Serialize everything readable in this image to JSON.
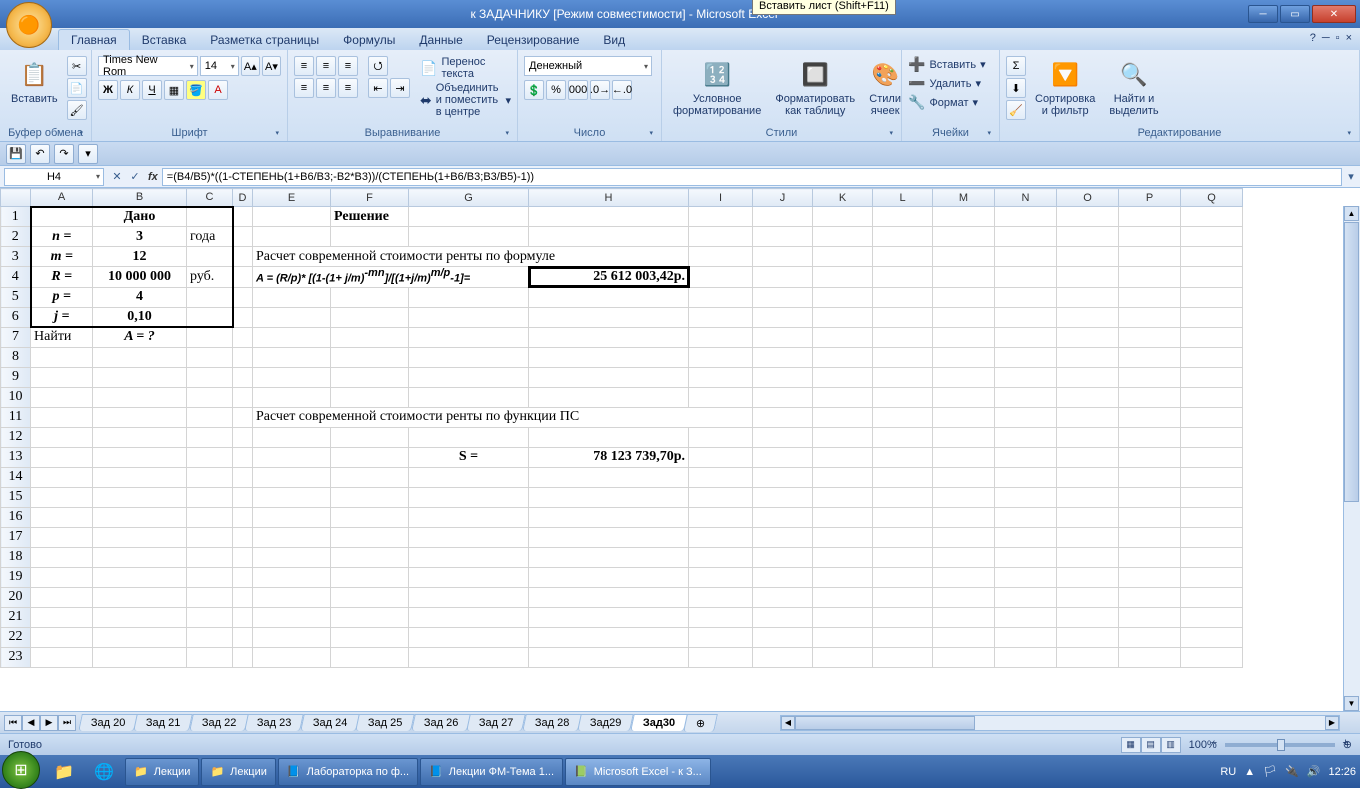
{
  "title": "к ЗАДАЧНИКУ  [Режим совместимости] - Microsoft Excel",
  "tabs": [
    "Главная",
    "Вставка",
    "Разметка страницы",
    "Формулы",
    "Данные",
    "Рецензирование",
    "Вид"
  ],
  "font": {
    "name": "Times New Rom",
    "size": "14"
  },
  "number_format": "Денежный",
  "ribbon": {
    "clipboard": {
      "paste": "Вставить",
      "title": "Буфер обмена"
    },
    "font_title": "Шрифт",
    "align": {
      "wrap": "Перенос текста",
      "merge": "Объединить и поместить в центре",
      "title": "Выравнивание"
    },
    "number_title": "Число",
    "styles": {
      "cond": "Условное\nформатирование",
      "table": "Форматировать\nкак таблицу",
      "cell": "Стили\nячеек",
      "title": "Стили"
    },
    "cells": {
      "insert": "Вставить",
      "delete": "Удалить",
      "format": "Формат",
      "title": "Ячейки"
    },
    "edit": {
      "sort": "Сортировка\nи фильтр",
      "find": "Найти и\nвыделить",
      "title": "Редактирование"
    }
  },
  "name_box": "H4",
  "formula_text": "=(B4/B5)*((1-СТЕПЕНЬ(1+B6/B3;-B2*B3))/(СТЕПЕНЬ(1+B6/B3;B3/B5)-1))",
  "cols": [
    "A",
    "B",
    "C",
    "D",
    "E",
    "F",
    "G",
    "H",
    "I",
    "J",
    "K",
    "L",
    "M",
    "N",
    "O",
    "P",
    "Q"
  ],
  "cells": {
    "r1": {
      "B": "Дано",
      "F": "Решение"
    },
    "r2": {
      "A": "n =",
      "B": "3",
      "C": "года"
    },
    "r3": {
      "A": "m =",
      "B": "12",
      "E": "Расчет современной стоимости ренты по формуле"
    },
    "r4": {
      "A": "R =",
      "B": "10 000 000",
      "C": "руб.",
      "E": "A = (R/p)* [(1-(1+ j/m)",
      "E2": "-mn",
      "E3": "]/[(1+j/m)",
      "E4": "m/p",
      "E5": "-1]=",
      "H": "25 612 003,42р."
    },
    "r5": {
      "A": "p =",
      "B": "4"
    },
    "r6": {
      "A": "j =",
      "B": "0,10"
    },
    "r7": {
      "A": "Найти",
      "B": "A = ?"
    },
    "r11": {
      "E": "Расчет современной стоимости ренты по функции ПС"
    },
    "r13": {
      "G": "S  =",
      "H": "78 123 739,70р."
    }
  },
  "sheet_tabs": [
    "Зад 20",
    "Зад 21",
    "Зад 22",
    "Зад 23",
    "Зад 24",
    "Зад 25",
    "Зад 26",
    "Зад 27",
    "Зад 28",
    "Зад29",
    "Зад30"
  ],
  "active_sheet": "Зад30",
  "tooltip": "Вставить лист (Shift+F11)",
  "status": "Готово",
  "zoom": "100%",
  "taskbar": {
    "items": [
      {
        "icon": "📁",
        "label": "Лекции"
      },
      {
        "icon": "📁",
        "label": "Лекции"
      },
      {
        "icon": "📘",
        "label": "Лабораторка по ф..."
      },
      {
        "icon": "📘",
        "label": "Лекции ФМ-Тема 1..."
      },
      {
        "icon": "📗",
        "label": "Microsoft Excel - к З...",
        "active": true
      }
    ],
    "lang": "RU",
    "time": "12:26"
  }
}
